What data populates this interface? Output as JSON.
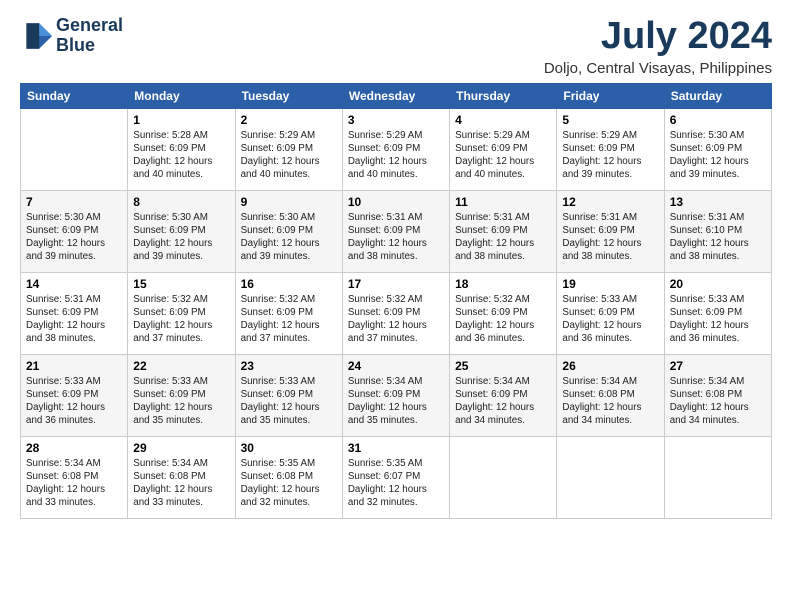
{
  "logo": {
    "line1": "General",
    "line2": "Blue"
  },
  "title": "July 2024",
  "location": "Doljo, Central Visayas, Philippines",
  "weekdays": [
    "Sunday",
    "Monday",
    "Tuesday",
    "Wednesday",
    "Thursday",
    "Friday",
    "Saturday"
  ],
  "weeks": [
    [
      {
        "date": "",
        "info": ""
      },
      {
        "date": "1",
        "info": "Sunrise: 5:28 AM\nSunset: 6:09 PM\nDaylight: 12 hours\nand 40 minutes."
      },
      {
        "date": "2",
        "info": "Sunrise: 5:29 AM\nSunset: 6:09 PM\nDaylight: 12 hours\nand 40 minutes."
      },
      {
        "date": "3",
        "info": "Sunrise: 5:29 AM\nSunset: 6:09 PM\nDaylight: 12 hours\nand 40 minutes."
      },
      {
        "date": "4",
        "info": "Sunrise: 5:29 AM\nSunset: 6:09 PM\nDaylight: 12 hours\nand 40 minutes."
      },
      {
        "date": "5",
        "info": "Sunrise: 5:29 AM\nSunset: 6:09 PM\nDaylight: 12 hours\nand 39 minutes."
      },
      {
        "date": "6",
        "info": "Sunrise: 5:30 AM\nSunset: 6:09 PM\nDaylight: 12 hours\nand 39 minutes."
      }
    ],
    [
      {
        "date": "7",
        "info": "Sunrise: 5:30 AM\nSunset: 6:09 PM\nDaylight: 12 hours\nand 39 minutes."
      },
      {
        "date": "8",
        "info": "Sunrise: 5:30 AM\nSunset: 6:09 PM\nDaylight: 12 hours\nand 39 minutes."
      },
      {
        "date": "9",
        "info": "Sunrise: 5:30 AM\nSunset: 6:09 PM\nDaylight: 12 hours\nand 39 minutes."
      },
      {
        "date": "10",
        "info": "Sunrise: 5:31 AM\nSunset: 6:09 PM\nDaylight: 12 hours\nand 38 minutes."
      },
      {
        "date": "11",
        "info": "Sunrise: 5:31 AM\nSunset: 6:09 PM\nDaylight: 12 hours\nand 38 minutes."
      },
      {
        "date": "12",
        "info": "Sunrise: 5:31 AM\nSunset: 6:09 PM\nDaylight: 12 hours\nand 38 minutes."
      },
      {
        "date": "13",
        "info": "Sunrise: 5:31 AM\nSunset: 6:10 PM\nDaylight: 12 hours\nand 38 minutes."
      }
    ],
    [
      {
        "date": "14",
        "info": "Sunrise: 5:31 AM\nSunset: 6:09 PM\nDaylight: 12 hours\nand 38 minutes."
      },
      {
        "date": "15",
        "info": "Sunrise: 5:32 AM\nSunset: 6:09 PM\nDaylight: 12 hours\nand 37 minutes."
      },
      {
        "date": "16",
        "info": "Sunrise: 5:32 AM\nSunset: 6:09 PM\nDaylight: 12 hours\nand 37 minutes."
      },
      {
        "date": "17",
        "info": "Sunrise: 5:32 AM\nSunset: 6:09 PM\nDaylight: 12 hours\nand 37 minutes."
      },
      {
        "date": "18",
        "info": "Sunrise: 5:32 AM\nSunset: 6:09 PM\nDaylight: 12 hours\nand 36 minutes."
      },
      {
        "date": "19",
        "info": "Sunrise: 5:33 AM\nSunset: 6:09 PM\nDaylight: 12 hours\nand 36 minutes."
      },
      {
        "date": "20",
        "info": "Sunrise: 5:33 AM\nSunset: 6:09 PM\nDaylight: 12 hours\nand 36 minutes."
      }
    ],
    [
      {
        "date": "21",
        "info": "Sunrise: 5:33 AM\nSunset: 6:09 PM\nDaylight: 12 hours\nand 36 minutes."
      },
      {
        "date": "22",
        "info": "Sunrise: 5:33 AM\nSunset: 6:09 PM\nDaylight: 12 hours\nand 35 minutes."
      },
      {
        "date": "23",
        "info": "Sunrise: 5:33 AM\nSunset: 6:09 PM\nDaylight: 12 hours\nand 35 minutes."
      },
      {
        "date": "24",
        "info": "Sunrise: 5:34 AM\nSunset: 6:09 PM\nDaylight: 12 hours\nand 35 minutes."
      },
      {
        "date": "25",
        "info": "Sunrise: 5:34 AM\nSunset: 6:09 PM\nDaylight: 12 hours\nand 34 minutes."
      },
      {
        "date": "26",
        "info": "Sunrise: 5:34 AM\nSunset: 6:08 PM\nDaylight: 12 hours\nand 34 minutes."
      },
      {
        "date": "27",
        "info": "Sunrise: 5:34 AM\nSunset: 6:08 PM\nDaylight: 12 hours\nand 34 minutes."
      }
    ],
    [
      {
        "date": "28",
        "info": "Sunrise: 5:34 AM\nSunset: 6:08 PM\nDaylight: 12 hours\nand 33 minutes."
      },
      {
        "date": "29",
        "info": "Sunrise: 5:34 AM\nSunset: 6:08 PM\nDaylight: 12 hours\nand 33 minutes."
      },
      {
        "date": "30",
        "info": "Sunrise: 5:35 AM\nSunset: 6:08 PM\nDaylight: 12 hours\nand 32 minutes."
      },
      {
        "date": "31",
        "info": "Sunrise: 5:35 AM\nSunset: 6:07 PM\nDaylight: 12 hours\nand 32 minutes."
      },
      {
        "date": "",
        "info": ""
      },
      {
        "date": "",
        "info": ""
      },
      {
        "date": "",
        "info": ""
      }
    ]
  ]
}
